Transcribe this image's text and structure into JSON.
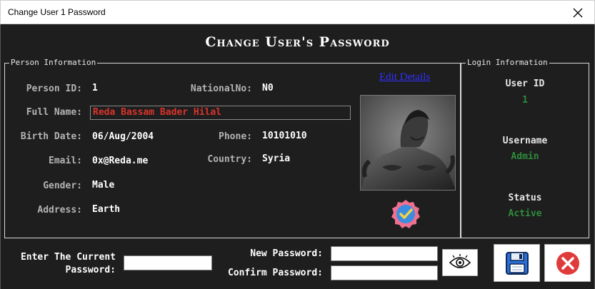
{
  "window": {
    "title": "Change User 1 Password"
  },
  "header": {
    "title": "Change User's Password"
  },
  "person": {
    "group_title": "Person Information",
    "person_id_label": "Person ID:",
    "person_id": "1",
    "national_no_label": "NationalNo:",
    "national_no": "N0",
    "full_name_label": "Full Name:",
    "full_name": "Reda Bassam Bader Hilal",
    "birth_date_label": "Birth Date:",
    "birth_date": "06/Aug/2004",
    "phone_label": "Phone:",
    "phone": "10101010",
    "email_label": "Email:",
    "email": "0x@Reda.me",
    "country_label": "Country:",
    "country": "Syria",
    "gender_label": "Gender:",
    "gender": "Male",
    "address_label": "Address:",
    "address": "Earth",
    "edit_link": "Edit Details"
  },
  "login": {
    "group_title": "Login Information",
    "user_id_label": "User ID",
    "user_id": "1",
    "username_label": "Username",
    "username": "Admin",
    "status_label": "Status",
    "status": "Active"
  },
  "password": {
    "current_label_line1": "Enter The Current",
    "current_label_line2": "Password:",
    "current_value": "",
    "new_label": "New Password:",
    "new_value": "",
    "confirm_label": "Confirm Password:",
    "confirm_value": ""
  },
  "icons": {
    "show_password": "eye-icon",
    "save": "floppy-disk-icon",
    "cancel": "cancel-icon",
    "verified": "verified-badge-icon",
    "close": "close-icon"
  },
  "colors": {
    "background": "#1e1e1e",
    "label_gray": "#b3b3b3",
    "full_name_red": "#d9342b",
    "status_green": "#2e8b3a",
    "link_blue": "#3030ff",
    "cancel_red": "#e03b3b",
    "save_blue": "#2a6fd6"
  }
}
